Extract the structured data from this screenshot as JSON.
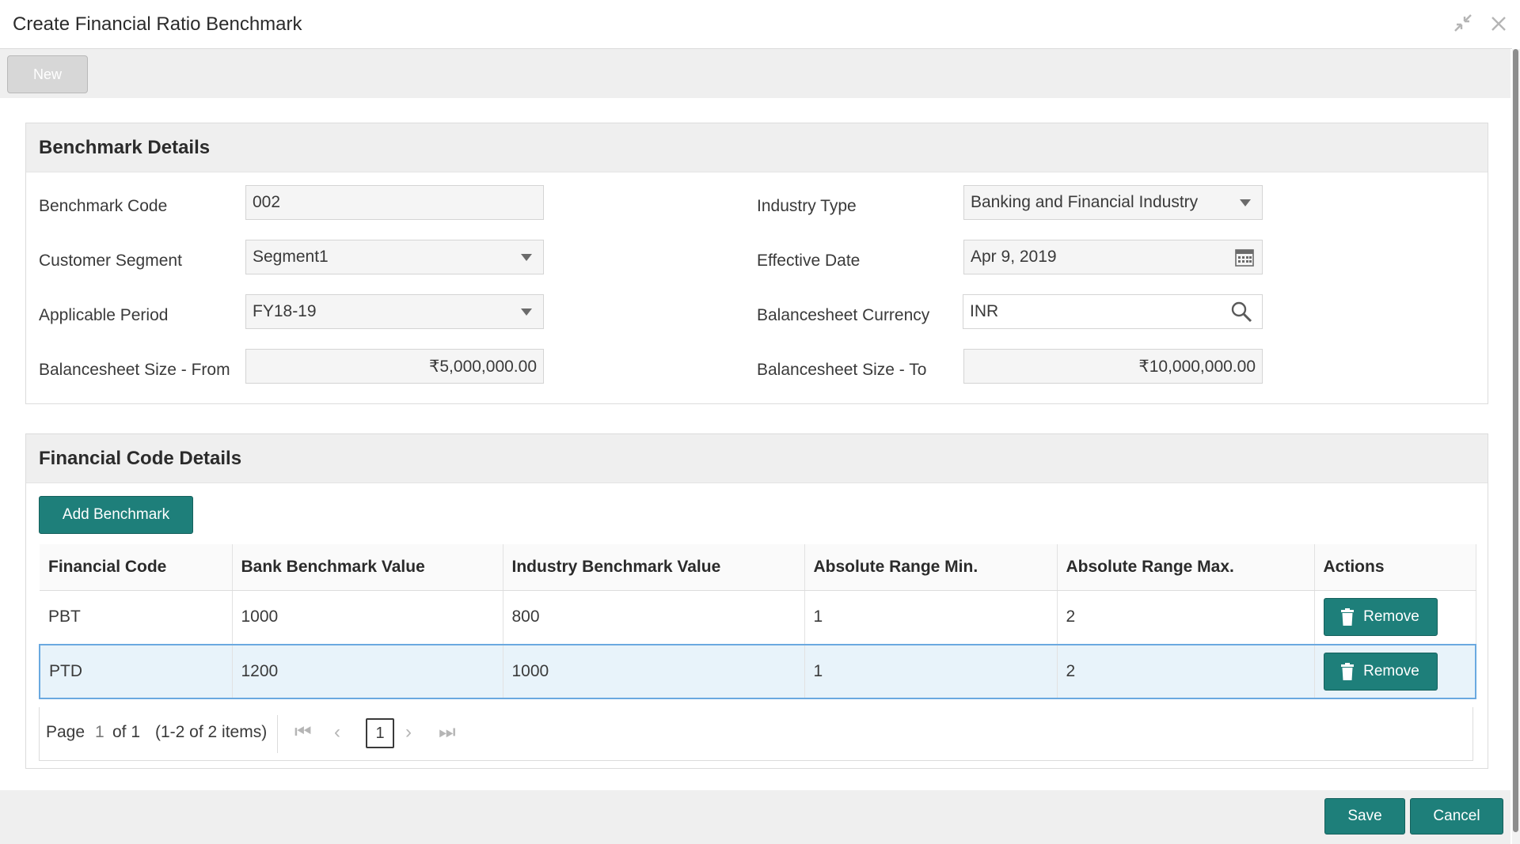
{
  "window": {
    "title": "Create Financial Ratio Benchmark",
    "minimize_icon": "collapse-icon",
    "close_icon": "close-icon"
  },
  "toolbar": {
    "new_label": "New"
  },
  "benchmark_details": {
    "heading": "Benchmark Details",
    "benchmark_code": {
      "label": "Benchmark Code",
      "value": "002"
    },
    "customer_segment": {
      "label": "Customer Segment",
      "value": "Segment1"
    },
    "applicable_period": {
      "label": "Applicable Period",
      "value": "FY18-19"
    },
    "balancesheet_size_from": {
      "label": "Balancesheet Size - From",
      "value": "₹5,000,000.00"
    },
    "industry_type": {
      "label": "Industry Type",
      "value": "Banking and Financial Industry"
    },
    "effective_date": {
      "label": "Effective Date",
      "value": "Apr 9, 2019"
    },
    "balancesheet_currency": {
      "label": "Balancesheet Currency",
      "value": "INR"
    },
    "balancesheet_size_to": {
      "label": "Balancesheet Size - To",
      "value": "₹10,000,000.00"
    }
  },
  "financial_code_details": {
    "heading": "Financial Code Details",
    "add_button": "Add Benchmark",
    "columns": [
      "Financial Code",
      "Bank Benchmark Value",
      "Industry Benchmark Value",
      "Absolute Range Min.",
      "Absolute Range Max.",
      "Actions"
    ],
    "rows": [
      {
        "code": "PBT",
        "bank": "1000",
        "industry": "800",
        "min": "1",
        "max": "2",
        "action": "Remove"
      },
      {
        "code": "PTD",
        "bank": "1200",
        "industry": "1000",
        "min": "1",
        "max": "2",
        "action": "Remove"
      }
    ],
    "pager": {
      "page_label": "Page",
      "current": "1",
      "of_label": "of 1",
      "summary": "(1-2 of 2 items)",
      "box_value": "1"
    }
  },
  "footer": {
    "save": "Save",
    "cancel": "Cancel"
  }
}
